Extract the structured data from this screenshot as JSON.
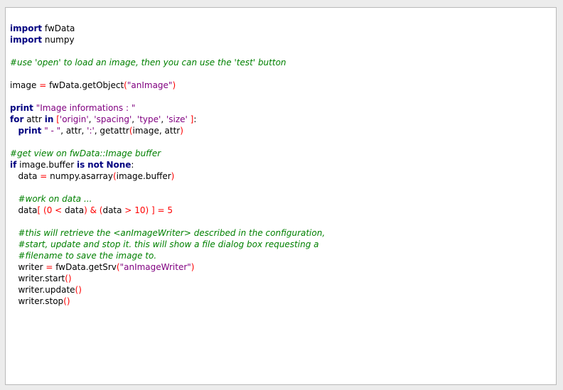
{
  "code_lines": [
    [
      {
        "t": "import",
        "c": "kw"
      },
      {
        "t": " fwData",
        "c": "nm"
      }
    ],
    [
      {
        "t": "import",
        "c": "kw"
      },
      {
        "t": " numpy",
        "c": "nm"
      }
    ],
    [],
    [
      {
        "t": "#use 'open' to load an image, then you can use the 'test' button",
        "c": "cm"
      }
    ],
    [],
    [
      {
        "t": "image ",
        "c": "nm"
      },
      {
        "t": "=",
        "c": "op"
      },
      {
        "t": " fwData.getObject",
        "c": "nm"
      },
      {
        "t": "(",
        "c": "op"
      },
      {
        "t": "\"anImage\"",
        "c": "st"
      },
      {
        "t": ")",
        "c": "op"
      }
    ],
    [],
    [
      {
        "t": "print",
        "c": "kw"
      },
      {
        "t": " ",
        "c": "nm"
      },
      {
        "t": "\"Image informations : \"",
        "c": "st"
      }
    ],
    [
      {
        "t": "for",
        "c": "kw"
      },
      {
        "t": " attr ",
        "c": "nm"
      },
      {
        "t": "in",
        "c": "kw"
      },
      {
        "t": " ",
        "c": "nm"
      },
      {
        "t": "[",
        "c": "op"
      },
      {
        "t": "'origin'",
        "c": "st"
      },
      {
        "t": ", ",
        "c": "nm"
      },
      {
        "t": "'spacing'",
        "c": "st"
      },
      {
        "t": ", ",
        "c": "nm"
      },
      {
        "t": "'type'",
        "c": "st"
      },
      {
        "t": ", ",
        "c": "nm"
      },
      {
        "t": "'size'",
        "c": "st"
      },
      {
        "t": " ]",
        "c": "op"
      },
      {
        "t": ":",
        "c": "nm"
      }
    ],
    [
      {
        "t": "   ",
        "c": "nm"
      },
      {
        "t": "print",
        "c": "kw"
      },
      {
        "t": " ",
        "c": "nm"
      },
      {
        "t": "\" - \"",
        "c": "st"
      },
      {
        "t": ", attr, ",
        "c": "nm"
      },
      {
        "t": "':'",
        "c": "st"
      },
      {
        "t": ", getattr",
        "c": "nm"
      },
      {
        "t": "(",
        "c": "op"
      },
      {
        "t": "image, attr",
        "c": "nm"
      },
      {
        "t": ")",
        "c": "op"
      }
    ],
    [],
    [
      {
        "t": "#get view on fwData::Image buffer",
        "c": "cm"
      }
    ],
    [
      {
        "t": "if",
        "c": "kw"
      },
      {
        "t": " image.buffer ",
        "c": "nm"
      },
      {
        "t": "is",
        "c": "kw"
      },
      {
        "t": " ",
        "c": "nm"
      },
      {
        "t": "not",
        "c": "kw"
      },
      {
        "t": " ",
        "c": "nm"
      },
      {
        "t": "None",
        "c": "kw"
      },
      {
        "t": ":",
        "c": "nm"
      }
    ],
    [
      {
        "t": "   data ",
        "c": "nm"
      },
      {
        "t": "=",
        "c": "op"
      },
      {
        "t": " numpy.asarray",
        "c": "nm"
      },
      {
        "t": "(",
        "c": "op"
      },
      {
        "t": "image.buffer",
        "c": "nm"
      },
      {
        "t": ")",
        "c": "op"
      }
    ],
    [],
    [
      {
        "t": "   ",
        "c": "nm"
      },
      {
        "t": "#work on data ...",
        "c": "cm"
      }
    ],
    [
      {
        "t": "   data",
        "c": "nm"
      },
      {
        "t": "[",
        "c": "op"
      },
      {
        "t": " ",
        "c": "nm"
      },
      {
        "t": "(",
        "c": "op"
      },
      {
        "t": "0",
        "c": "op"
      },
      {
        "t": " ",
        "c": "nm"
      },
      {
        "t": "<",
        "c": "op"
      },
      {
        "t": " data",
        "c": "nm"
      },
      {
        "t": ")",
        "c": "op"
      },
      {
        "t": " ",
        "c": "nm"
      },
      {
        "t": "&",
        "c": "op"
      },
      {
        "t": " ",
        "c": "nm"
      },
      {
        "t": "(",
        "c": "op"
      },
      {
        "t": "data ",
        "c": "nm"
      },
      {
        "t": ">",
        "c": "op"
      },
      {
        "t": " ",
        "c": "nm"
      },
      {
        "t": "10",
        "c": "op"
      },
      {
        "t": ")",
        "c": "op"
      },
      {
        "t": " ]",
        "c": "op"
      },
      {
        "t": " ",
        "c": "nm"
      },
      {
        "t": "=",
        "c": "op"
      },
      {
        "t": " ",
        "c": "nm"
      },
      {
        "t": "5",
        "c": "op"
      }
    ],
    [],
    [
      {
        "t": "   ",
        "c": "nm"
      },
      {
        "t": "#this will retrieve the <anImageWriter> described in the configuration,",
        "c": "cm"
      }
    ],
    [
      {
        "t": "   ",
        "c": "nm"
      },
      {
        "t": "#start, update and stop it. this will show a file dialog box requesting a",
        "c": "cm"
      }
    ],
    [
      {
        "t": "   ",
        "c": "nm"
      },
      {
        "t": "#filename to save the image to.",
        "c": "cm"
      }
    ],
    [
      {
        "t": "   writer ",
        "c": "nm"
      },
      {
        "t": "=",
        "c": "op"
      },
      {
        "t": " fwData.getSrv",
        "c": "nm"
      },
      {
        "t": "(",
        "c": "op"
      },
      {
        "t": "\"anImageWriter\"",
        "c": "st"
      },
      {
        "t": ")",
        "c": "op"
      }
    ],
    [
      {
        "t": "   writer.start",
        "c": "nm"
      },
      {
        "t": "()",
        "c": "op"
      }
    ],
    [
      {
        "t": "   writer.update",
        "c": "nm"
      },
      {
        "t": "()",
        "c": "op"
      }
    ],
    [
      {
        "t": "   writer.stop",
        "c": "nm"
      },
      {
        "t": "()",
        "c": "op"
      }
    ]
  ]
}
